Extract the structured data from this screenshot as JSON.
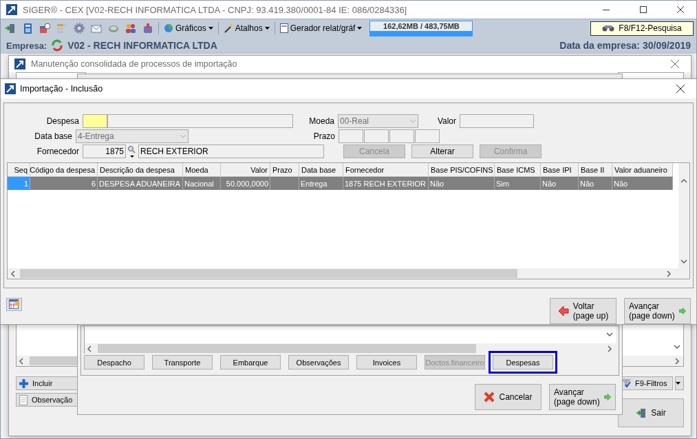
{
  "app_window": {
    "title": "SIGER® - CEX [V02-RECH INFORMATICA LTDA - CNPJ: 93.419.380/0001-84 IE: 086/0284336]",
    "menus": [
      {
        "label": "Gráficos"
      },
      {
        "label": "Atalhos"
      },
      {
        "label": "Gerador relat/gráf"
      }
    ],
    "memory": "162,62MB / 483,75MB",
    "search_button": "F8/F12-Pesquisa",
    "company_label": "Empresa:",
    "company": "V02 - RECH INFORMATICA LTDA",
    "date_label": "Data da empresa:",
    "date": "30/09/2019"
  },
  "maintenance_window": {
    "title": "Manutenção consolidada de processos de importação",
    "buttons": [
      {
        "label": "Incluir"
      },
      {
        "label": "Observação"
      }
    ],
    "filter_button": "F9-Filtros",
    "exit_button": "Sair"
  },
  "process_dialog": {
    "tabs": [
      {
        "label": "Despacho",
        "disabled": false,
        "focused": false
      },
      {
        "label": "Transporte",
        "disabled": false,
        "focused": false
      },
      {
        "label": "Embarque",
        "disabled": false,
        "focused": false
      },
      {
        "label": "Observações",
        "disabled": false,
        "focused": false
      },
      {
        "label": "Invoices",
        "disabled": false,
        "focused": false
      },
      {
        "label": "Doctos.financeiro",
        "disabled": true,
        "focused": false
      },
      {
        "label": "Despesas",
        "disabled": false,
        "focused": true
      }
    ],
    "cancel_button": "Cancelar",
    "next_button": {
      "label": "Avançar",
      "hint": "(page down)"
    }
  },
  "import_dialog": {
    "title": "Importação - Inclusão",
    "form": {
      "expense": {
        "label": "Despesa"
      },
      "currency": {
        "label": "Moeda",
        "value": "00-Real",
        "disabled": true
      },
      "amount": {
        "label": "Valor"
      },
      "base_date": {
        "label": "Data base",
        "value": "4-Entrega",
        "disabled": true
      },
      "term": {
        "label": "Prazo"
      },
      "supplier": {
        "label": "Fornecedor",
        "code": "1875",
        "name": "RECH EXTERIOR"
      }
    },
    "actions": [
      {
        "label": "Cancela",
        "disabled": true
      },
      {
        "label": "Alterar",
        "disabled": false
      },
      {
        "label": "Confirma",
        "disabled": true
      }
    ],
    "table": {
      "columns": [
        {
          "label": "Seq",
          "numeric": true
        },
        {
          "label": "Código da despesa",
          "numeric": true
        },
        {
          "label": "Descrição da despesa",
          "numeric": false
        },
        {
          "label": "Moeda",
          "numeric": false
        },
        {
          "label": "Valor",
          "numeric": true
        },
        {
          "label": "Prazo",
          "numeric": false
        },
        {
          "label": "Data base",
          "numeric": false
        },
        {
          "label": "Fornecedor",
          "numeric": false
        },
        {
          "label": "Base PIS/COFINS",
          "numeric": false
        },
        {
          "label": "Base ICMS",
          "numeric": false
        },
        {
          "label": "Base IPI",
          "numeric": false
        },
        {
          "label": "Base II",
          "numeric": false
        },
        {
          "label": "Valor aduaneiro",
          "numeric": false
        }
      ],
      "rows": [
        {
          "selected": true,
          "cells": [
            "1",
            "6",
            "DESPESA ADUANEIRA",
            "Nacional",
            "50.000,0000",
            null,
            "Entrega",
            "1875 RECH EXTERIOR",
            "Não",
            "Sim",
            "Não",
            "Não",
            "Não"
          ]
        }
      ]
    },
    "back_button": {
      "label": "Voltar",
      "hint": "(page up)"
    },
    "next_button": {
      "label": "Avançar",
      "hint": "(page down)"
    }
  }
}
